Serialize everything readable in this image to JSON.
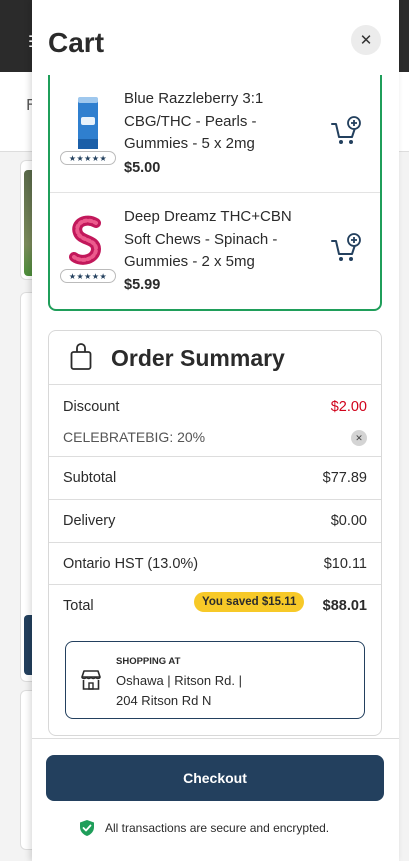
{
  "drawer": {
    "title": "Cart",
    "close_icon": "close-icon"
  },
  "background": {
    "nav_letter": "F",
    "menu_icon": "menu-icon"
  },
  "products": [
    {
      "name": "Blue Razzleberry 3:1 CBG/THC - Pearls - Gummies - 5 x 2mg",
      "price": "$5.00",
      "rating_stars": "★★★★★",
      "icon": "add-to-cart-icon"
    },
    {
      "name": "Deep Dreamz THC+CBN Soft Chews - Spinach - Gummies - 2 x 5mg",
      "price": "$5.99",
      "rating_stars": "★★★★★",
      "icon": "add-to-cart-icon"
    }
  ],
  "summary": {
    "title": "Order Summary",
    "discount_label": "Discount",
    "discount_value": "$2.00",
    "promo_code": "CELEBRATEBIG: 20%",
    "subtotal_label": "Subtotal",
    "subtotal_value": "$77.89",
    "delivery_label": "Delivery",
    "delivery_value": "$0.00",
    "tax_label": "Ontario HST (13.0%)",
    "tax_value": "$10.11",
    "total_label": "Total",
    "saved_badge": "You saved $15.11",
    "total_value": "$88.01"
  },
  "shop": {
    "label": "SHOPPING AT",
    "line1": "Oshawa | Ritson Rd. |",
    "line2": "204 Ritson Rd N"
  },
  "footer": {
    "checkout_label": "Checkout",
    "secure_text": "All transactions are secure and encrypted."
  },
  "colors": {
    "accent_navy": "#23405e",
    "product_border_green": "#1f9e5a",
    "discount_red": "#d0021b",
    "badge_yellow": "#f7c928",
    "secure_green": "#1f9e5a"
  }
}
